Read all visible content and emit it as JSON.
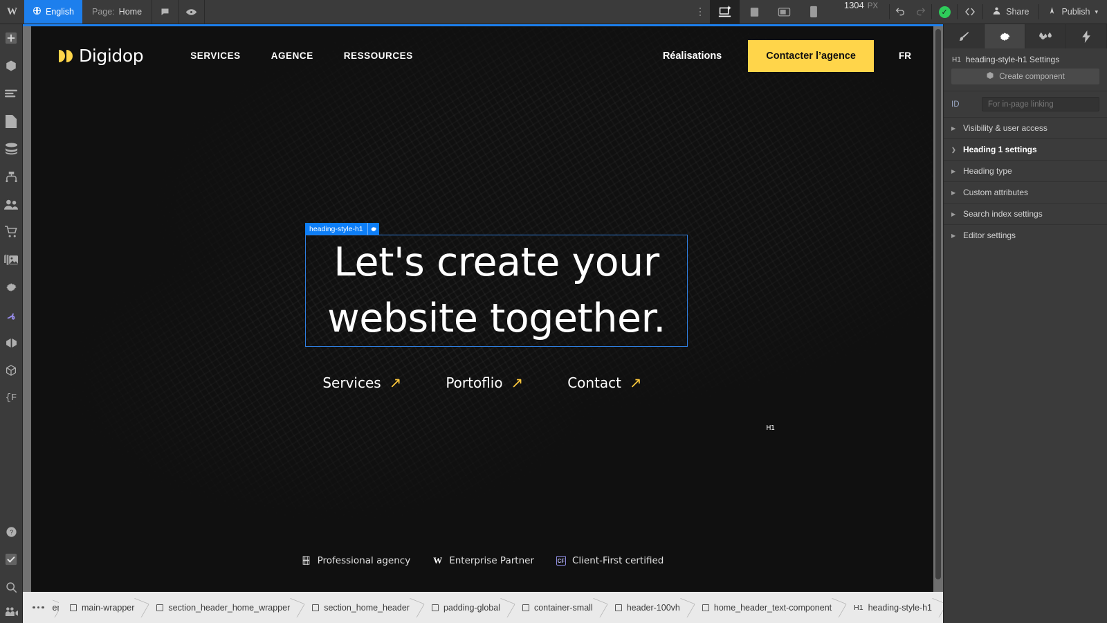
{
  "topbar": {
    "logo": "W",
    "language": "English",
    "globe_icon": "globe-icon",
    "page_label": "Page:",
    "page_name": "Home",
    "comment_icon": "comment-icon",
    "preview_icon": "eye-icon",
    "more_icon": "more-vertical-icon",
    "breakpoints": [
      {
        "name": "desktop-large",
        "icon": "laptop-star-icon",
        "active": true
      },
      {
        "name": "desktop",
        "icon": "desktop-icon",
        "active": false
      },
      {
        "name": "tablet",
        "icon": "tablet-icon",
        "active": false
      },
      {
        "name": "mobile",
        "icon": "mobile-icon",
        "active": false
      }
    ],
    "viewport_width": "1304",
    "viewport_unit": "PX",
    "undo_icon": "undo-icon",
    "redo_icon": "redo-icon",
    "status_icon": "check-circle-icon",
    "code_icon": "code-icon",
    "share_label": "Share",
    "share_icon": "person-icon",
    "publish_label": "Publish",
    "publish_icon": "rocket-icon",
    "publish_caret": "chevron-down-icon"
  },
  "rail": {
    "items": [
      {
        "name": "add-panel",
        "icon": "plus-icon"
      },
      {
        "name": "components-panel",
        "icon": "cube-icon"
      },
      {
        "name": "navigator-panel",
        "icon": "layers-icon"
      },
      {
        "name": "pages-panel",
        "icon": "page-icon"
      },
      {
        "name": "cms-panel",
        "icon": "database-icon"
      },
      {
        "name": "logic-panel",
        "icon": "logic-icon"
      },
      {
        "name": "users-panel",
        "icon": "users-icon"
      },
      {
        "name": "ecommerce-panel",
        "icon": "cart-icon"
      },
      {
        "name": "assets-panel",
        "icon": "images-icon"
      },
      {
        "name": "settings-panel",
        "icon": "gear-icon"
      },
      {
        "name": "interactions-panel",
        "icon": "interactions-icon"
      },
      {
        "name": "variants-panel",
        "icon": "variants-icon"
      },
      {
        "name": "libraries-panel",
        "icon": "cube-outline-icon"
      },
      {
        "name": "variables-panel",
        "icon": "braces-f-icon"
      }
    ],
    "bottom_items": [
      {
        "name": "help",
        "icon": "question-circle-icon"
      },
      {
        "name": "audit",
        "icon": "checkbox-icon"
      },
      {
        "name": "search",
        "icon": "search-icon"
      },
      {
        "name": "collaborate",
        "icon": "video-people-icon"
      }
    ]
  },
  "site": {
    "brand": "Digidop",
    "nav_links": [
      "SERVICES",
      "AGENCE",
      "RESSOURCES"
    ],
    "nav_right_link": "Réalisations",
    "cta_label": "Contacter l’agence",
    "lang_label": "FR",
    "heading_line1": "Let's create your",
    "heading_line2": "website together.",
    "hero_links": [
      {
        "label": "Services",
        "arrow": "arrow-up-right-icon"
      },
      {
        "label": "Portoflio",
        "arrow": "arrow-up-right-icon"
      },
      {
        "label": "Contact",
        "arrow": "arrow-up-right-icon"
      }
    ],
    "badges": [
      {
        "icon": "figma-icon",
        "label": "Professional agency"
      },
      {
        "icon": "webflow-icon",
        "label": "Enterprise Partner"
      },
      {
        "icon": "client-first-icon",
        "label": "Client-First certified"
      }
    ],
    "accent_color": "#FFD54A",
    "background_color": "#101010"
  },
  "selection": {
    "tag_type": "H1",
    "tag_label": "heading-style-h1",
    "gear_icon": "gear-icon",
    "highlight_color": "#0d7ef7"
  },
  "panel": {
    "tabs": [
      {
        "name": "style",
        "icon": "brush-icon",
        "active": false
      },
      {
        "name": "settings",
        "icon": "gear-icon",
        "active": true
      },
      {
        "name": "styles-manager",
        "icon": "drops-icon",
        "active": false
      },
      {
        "name": "interactions",
        "icon": "bolt-icon",
        "active": false
      }
    ],
    "title_tag": "H1",
    "title": "heading-style-h1 Settings",
    "create_component_label": "Create component",
    "create_component_icon": "cube-icon",
    "id_label": "ID",
    "id_placeholder": "For in-page linking",
    "sections": [
      {
        "label": "Visibility & user access",
        "bold": false
      },
      {
        "label": "Heading 1 settings",
        "bold": true
      },
      {
        "label": "Heading type",
        "bold": false
      },
      {
        "label": "Custom attributes",
        "bold": false
      },
      {
        "label": "Search index settings",
        "bold": false
      },
      {
        "label": "Editor settings",
        "bold": false
      }
    ]
  },
  "breadcrumbs": {
    "overflow_icon": "ellipsis-icon",
    "truncated": "er",
    "items": [
      {
        "label": "main-wrapper",
        "type": "box"
      },
      {
        "label": "section_header_home_wrapper",
        "type": "box"
      },
      {
        "label": "section_home_header",
        "type": "box"
      },
      {
        "label": "padding-global",
        "type": "box"
      },
      {
        "label": "container-small",
        "type": "box"
      },
      {
        "label": "header-100vh",
        "type": "box"
      },
      {
        "label": "home_header_text-component",
        "type": "box"
      },
      {
        "label": "heading-style-h1",
        "type": "h1"
      }
    ]
  }
}
